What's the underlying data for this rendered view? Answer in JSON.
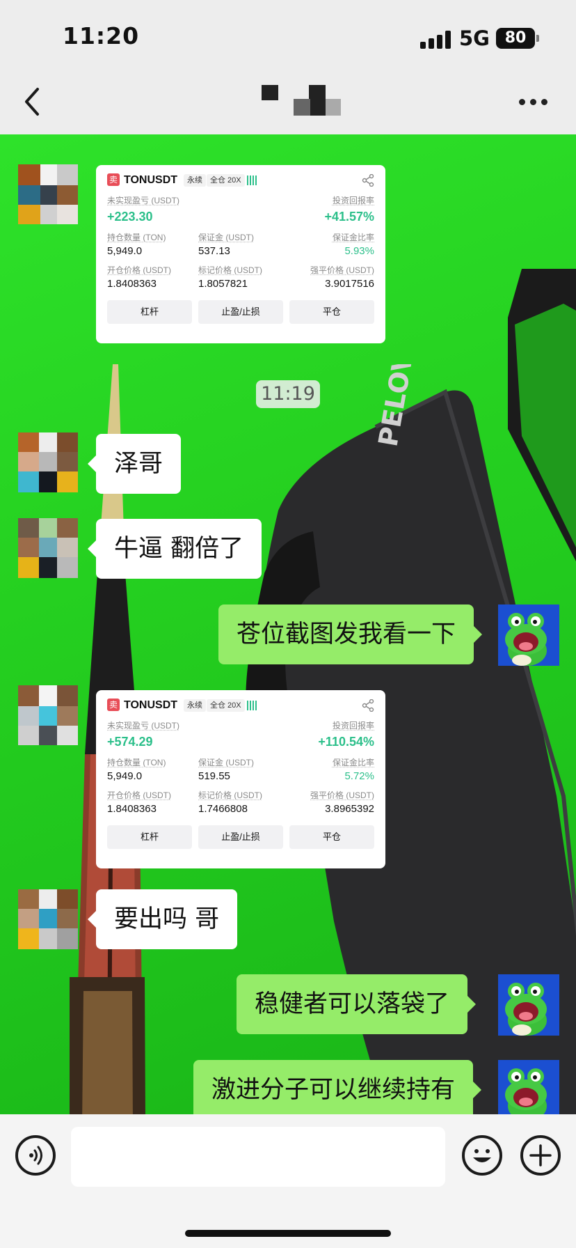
{
  "status_bar": {
    "time": "11:20",
    "network": "5G",
    "battery": "80"
  },
  "timestamp": "11:19",
  "trade_cards": [
    {
      "side_tag": "卖",
      "symbol": "TONUSDT",
      "contract_type": "永续",
      "margin_mode": "全仓 20X",
      "unrealized_pnl_label": "未实现盈亏 (USDT)",
      "unrealized_pnl": "+223.30",
      "roi_label": "投资回报率",
      "roi": "+41.57%",
      "position_size_label": "持仓数量 (TON)",
      "position_size": "5,949.0",
      "margin_label": "保证金 (USDT)",
      "margin": "537.13",
      "margin_ratio_label": "保证金比率",
      "margin_ratio": "5.93%",
      "entry_price_label": "开仓价格 (USDT)",
      "entry_price": "1.8408363",
      "mark_price_label": "标记价格 (USDT)",
      "mark_price": "1.8057821",
      "liq_price_label": "强平价格 (USDT)",
      "liq_price": "3.9017516",
      "buttons": [
        "杠杆",
        "止盈/止损",
        "平仓"
      ]
    },
    {
      "side_tag": "卖",
      "symbol": "TONUSDT",
      "contract_type": "永续",
      "margin_mode": "全仓 20X",
      "unrealized_pnl_label": "未实现盈亏 (USDT)",
      "unrealized_pnl": "+574.29",
      "roi_label": "投资回报率",
      "roi": "+110.54%",
      "position_size_label": "持仓数量 (TON)",
      "position_size": "5,949.0",
      "margin_label": "保证金 (USDT)",
      "margin": "519.55",
      "margin_ratio_label": "保证金比率",
      "margin_ratio": "5.72%",
      "entry_price_label": "开仓价格 (USDT)",
      "entry_price": "1.8408363",
      "mark_price_label": "标记价格 (USDT)",
      "mark_price": "1.7466808",
      "liq_price_label": "强平价格 (USDT)",
      "liq_price": "3.8965392",
      "buttons": [
        "杠杆",
        "止盈/止损",
        "平仓"
      ]
    }
  ],
  "messages": [
    {
      "side": "in",
      "text": "泽哥"
    },
    {
      "side": "in",
      "text": "牛逼 翻倍了"
    },
    {
      "side": "out",
      "text": "苍位截图发我看一下"
    },
    {
      "side": "in",
      "text": "要出吗 哥"
    },
    {
      "side": "out",
      "text": "稳健者可以落袋了"
    },
    {
      "side": "out",
      "text": "激进分子可以继续持有"
    }
  ],
  "colors": {
    "incoming": "#ffffff",
    "outgoing": "#95ec69",
    "profit_green": "#2bbf8a",
    "felt_green": "#25d020"
  },
  "icons": [
    "back-arrow-icon",
    "more-dots-icon",
    "voice-icon",
    "emoji-icon",
    "plus-icon",
    "share-icon",
    "signal-icon"
  ]
}
